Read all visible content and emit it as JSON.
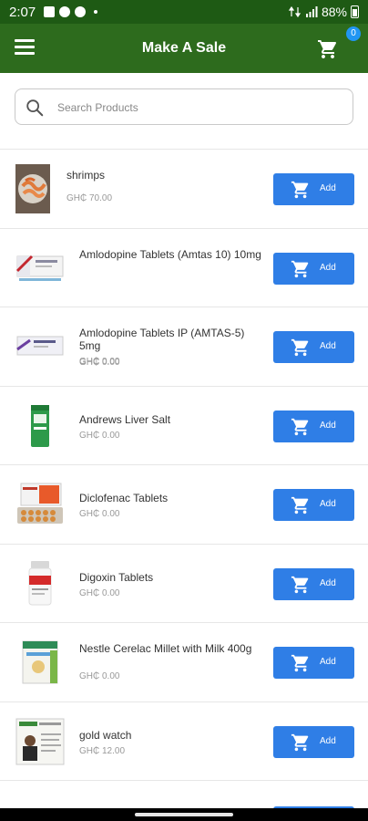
{
  "status_bar": {
    "time": "2:07",
    "battery": "88%"
  },
  "app_bar": {
    "title": "Make A Sale",
    "cart_count": "0"
  },
  "search": {
    "placeholder": "Search Products",
    "value": ""
  },
  "colors": {
    "app_bar": "#2d6b1d",
    "status_bar": "#1e5a14",
    "button": "#2f7ee6",
    "badge": "#2196f3"
  },
  "products": [
    {
      "name": "shrimps",
      "price": "GH₵ 70.00",
      "thumb_icon": "shrimp-image",
      "add_label": "Add"
    },
    {
      "name": "Amlodopine Tablets (Amtas 10) 10mg",
      "price": "GH₵ 0.00",
      "thumb_icon": "medicine-box-image",
      "add_label": "Add"
    },
    {
      "name": "Amlodopine Tablets IP (AMTAS-5) 5mg",
      "price": "GH₵ 0.00",
      "thumb_icon": "medicine-box-image",
      "add_label": "Add"
    },
    {
      "name": "Andrews Liver Salt",
      "price": "GH₵ 0.00",
      "thumb_icon": "salt-tin-image",
      "add_label": "Add"
    },
    {
      "name": "Diclofenac Tablets",
      "price": "GH₵ 0.00",
      "thumb_icon": "tablet-pack-image",
      "add_label": "Add"
    },
    {
      "name": "Digoxin Tablets",
      "price": "GH₵ 0.00",
      "thumb_icon": "pill-bottle-image",
      "add_label": "Add"
    },
    {
      "name": "Nestle Cerelac Millet with Milk 400g",
      "price": "GH₵ 0.00",
      "thumb_icon": "cereal-box-image",
      "add_label": "Add"
    },
    {
      "name": "gold watch",
      "price": "GH₵ 12.00",
      "thumb_icon": "poster-image",
      "add_label": "Add"
    }
  ]
}
